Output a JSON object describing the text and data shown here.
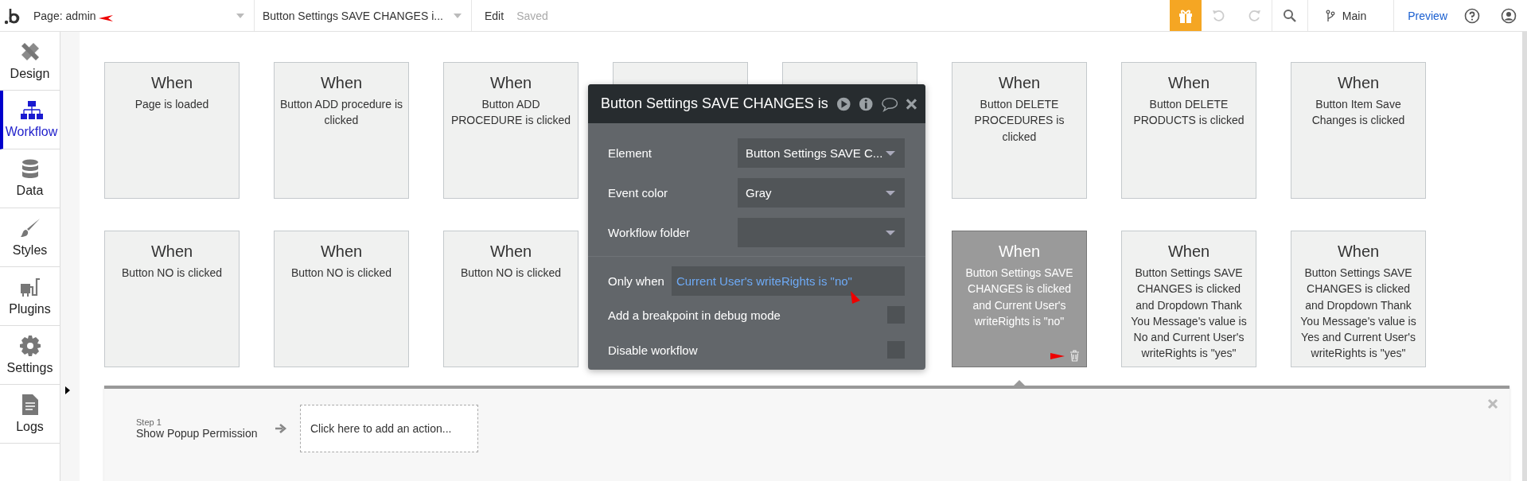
{
  "topbar": {
    "page_selector": "Page: admin",
    "workflow_selector": "Button Settings SAVE CHANGES i...",
    "edit": "Edit",
    "saved": "Saved",
    "branch": "Main",
    "preview": "Preview"
  },
  "sidebar": {
    "items": [
      {
        "label": "Design",
        "kind": "design",
        "selected": false
      },
      {
        "label": "Workflow",
        "kind": "workflow",
        "selected": true
      },
      {
        "label": "Data",
        "kind": "data",
        "selected": false
      },
      {
        "label": "Styles",
        "kind": "styles",
        "selected": false
      },
      {
        "label": "Plugins",
        "kind": "plugins",
        "selected": false
      },
      {
        "label": "Settings",
        "kind": "settings",
        "selected": false
      },
      {
        "label": "Logs",
        "kind": "logs",
        "selected": false
      }
    ]
  },
  "canvas": {
    "rows": [
      {
        "cards": [
          {
            "kind": "event",
            "title": "When",
            "text": "Page is loaded",
            "selected": false
          },
          {
            "kind": "event",
            "title": "When",
            "text": "Button ADD procedure is clicked",
            "selected": false
          },
          {
            "kind": "event",
            "title": "When",
            "text": "Button ADD PROCEDURE is clicked",
            "selected": false
          },
          {
            "kind": "partial"
          },
          {
            "kind": "partial"
          },
          {
            "kind": "event",
            "title": "When",
            "text": "Button DELETE PROCEDURES is clicked",
            "selected": false
          },
          {
            "kind": "event",
            "title": "When",
            "text": "Button DELETE PRODUCTS is clicked",
            "selected": false
          },
          {
            "kind": "event",
            "title": "When",
            "text": "Button Item Save Changes is clicked",
            "selected": false
          }
        ]
      },
      {
        "cards": [
          {
            "kind": "event",
            "title": "When",
            "text": "Button NO is clicked",
            "selected": false
          },
          {
            "kind": "event",
            "title": "When",
            "text": "Button NO is clicked",
            "selected": false
          },
          {
            "kind": "event",
            "title": "When",
            "text": "Button NO is clicked",
            "selected": false
          },
          {
            "kind": "covered"
          },
          {
            "kind": "covered"
          },
          {
            "kind": "event",
            "title": "When",
            "text": "Button Settings SAVE CHANGES is clicked and Current User's writeRights is \"no\"",
            "selected": true
          },
          {
            "kind": "event",
            "title": "When",
            "text": "Button Settings SAVE CHANGES is clicked and Dropdown Thank You Message's value is No and Current User's writeRights is \"yes\"",
            "selected": false
          },
          {
            "kind": "event",
            "title": "When",
            "text": "Button Settings SAVE CHANGES is clicked and Dropdown Thank You Message's value is Yes and Current User's writeRights is \"yes\"",
            "selected": false
          }
        ]
      }
    ]
  },
  "popup": {
    "title": "Button Settings SAVE CHANGES is",
    "fields": [
      {
        "label": "Element",
        "value": "Button Settings SAVE C..."
      },
      {
        "label": "Event color",
        "value": "Gray"
      },
      {
        "label": "Workflow folder"
      }
    ],
    "condition": {
      "label": "Only when",
      "value": "Current User's writeRights is \"no\""
    },
    "options": [
      {
        "label": "Add a breakpoint in debug mode",
        "checked": false
      },
      {
        "label": "Disable workflow",
        "checked": false
      }
    ]
  },
  "steps_panel": {
    "steps": [
      {
        "number": "Step 1",
        "name": "Show Popup Permission"
      }
    ],
    "add_action": "Click here to add an action..."
  }
}
